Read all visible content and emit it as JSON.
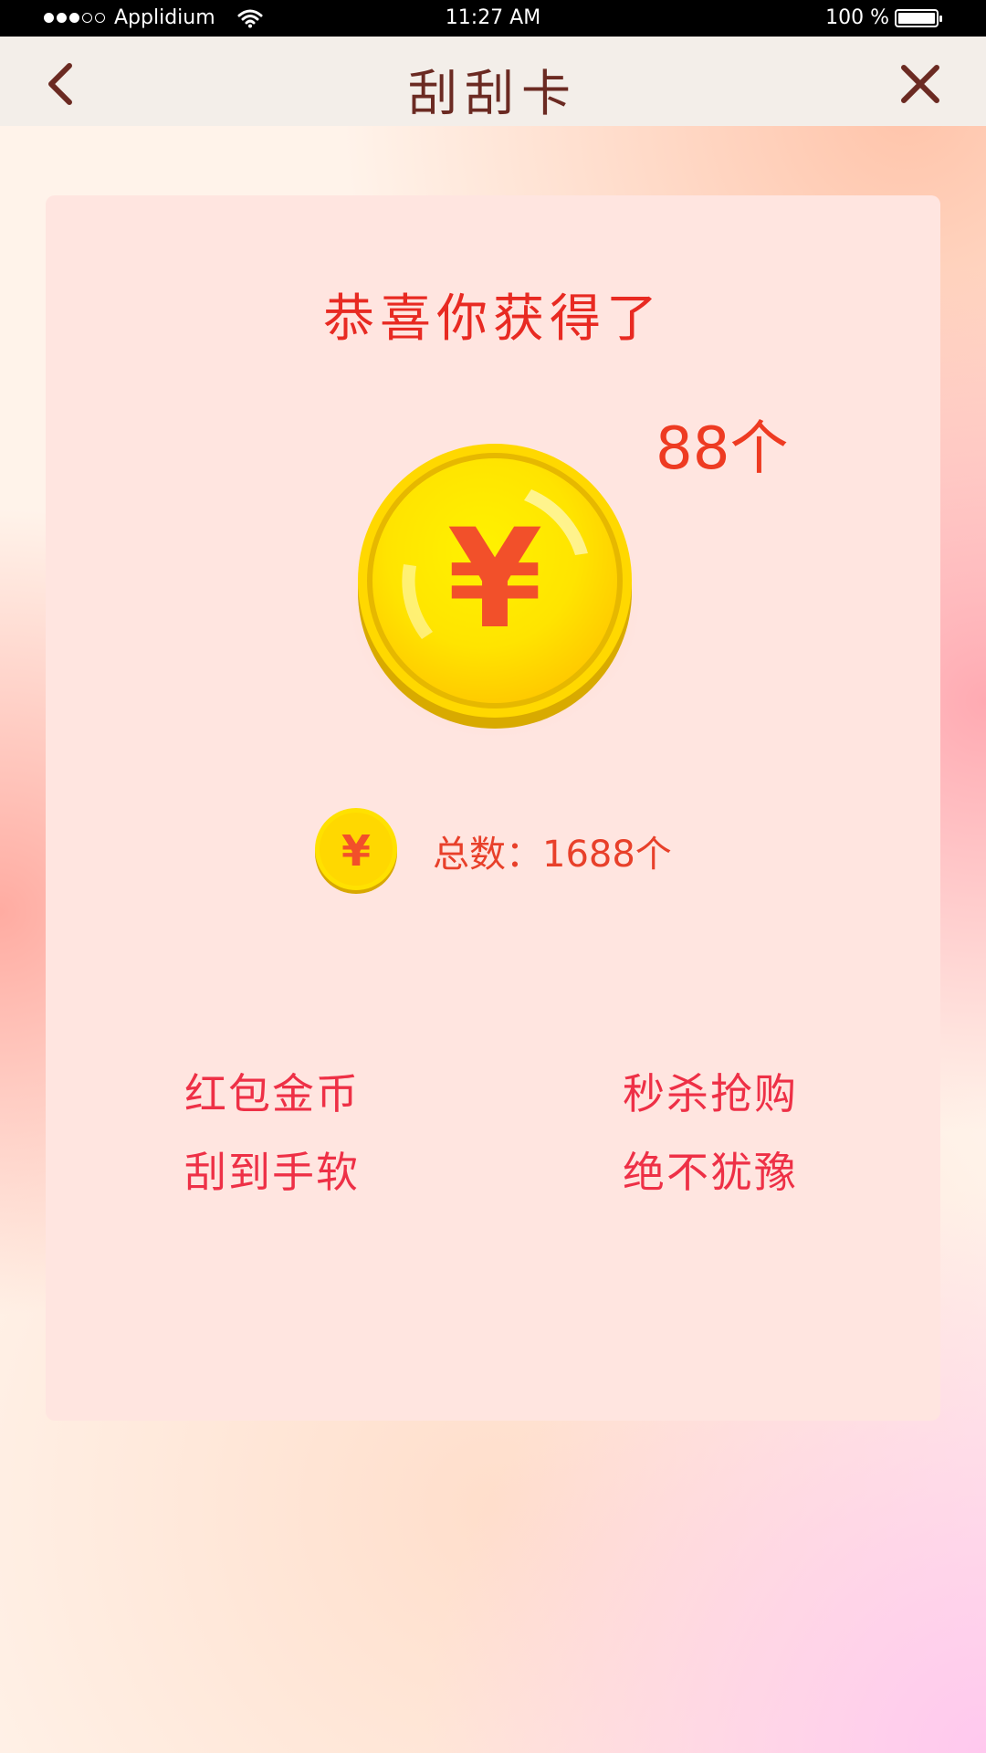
{
  "status_bar": {
    "carrier": "Applidium",
    "time": "11:27 AM",
    "battery": "100 %",
    "signal_dots_filled": 3,
    "signal_dots_total": 5
  },
  "nav": {
    "title": "刮刮卡",
    "back_icon": "chevron-left-icon",
    "close_icon": "close-icon"
  },
  "card": {
    "congrats": "恭喜你获得了",
    "amount": "88个",
    "coin_symbol": "¥",
    "total_label": "总数：1688个",
    "slogans": [
      "红包金币",
      "秒杀抢购",
      "刮到手软",
      "绝不犹豫"
    ]
  },
  "colors": {
    "title_red": "#e82a22",
    "slogan_red": "#ee3046",
    "nav_text": "#6b2a22",
    "coin_gold": "#ffd400"
  }
}
